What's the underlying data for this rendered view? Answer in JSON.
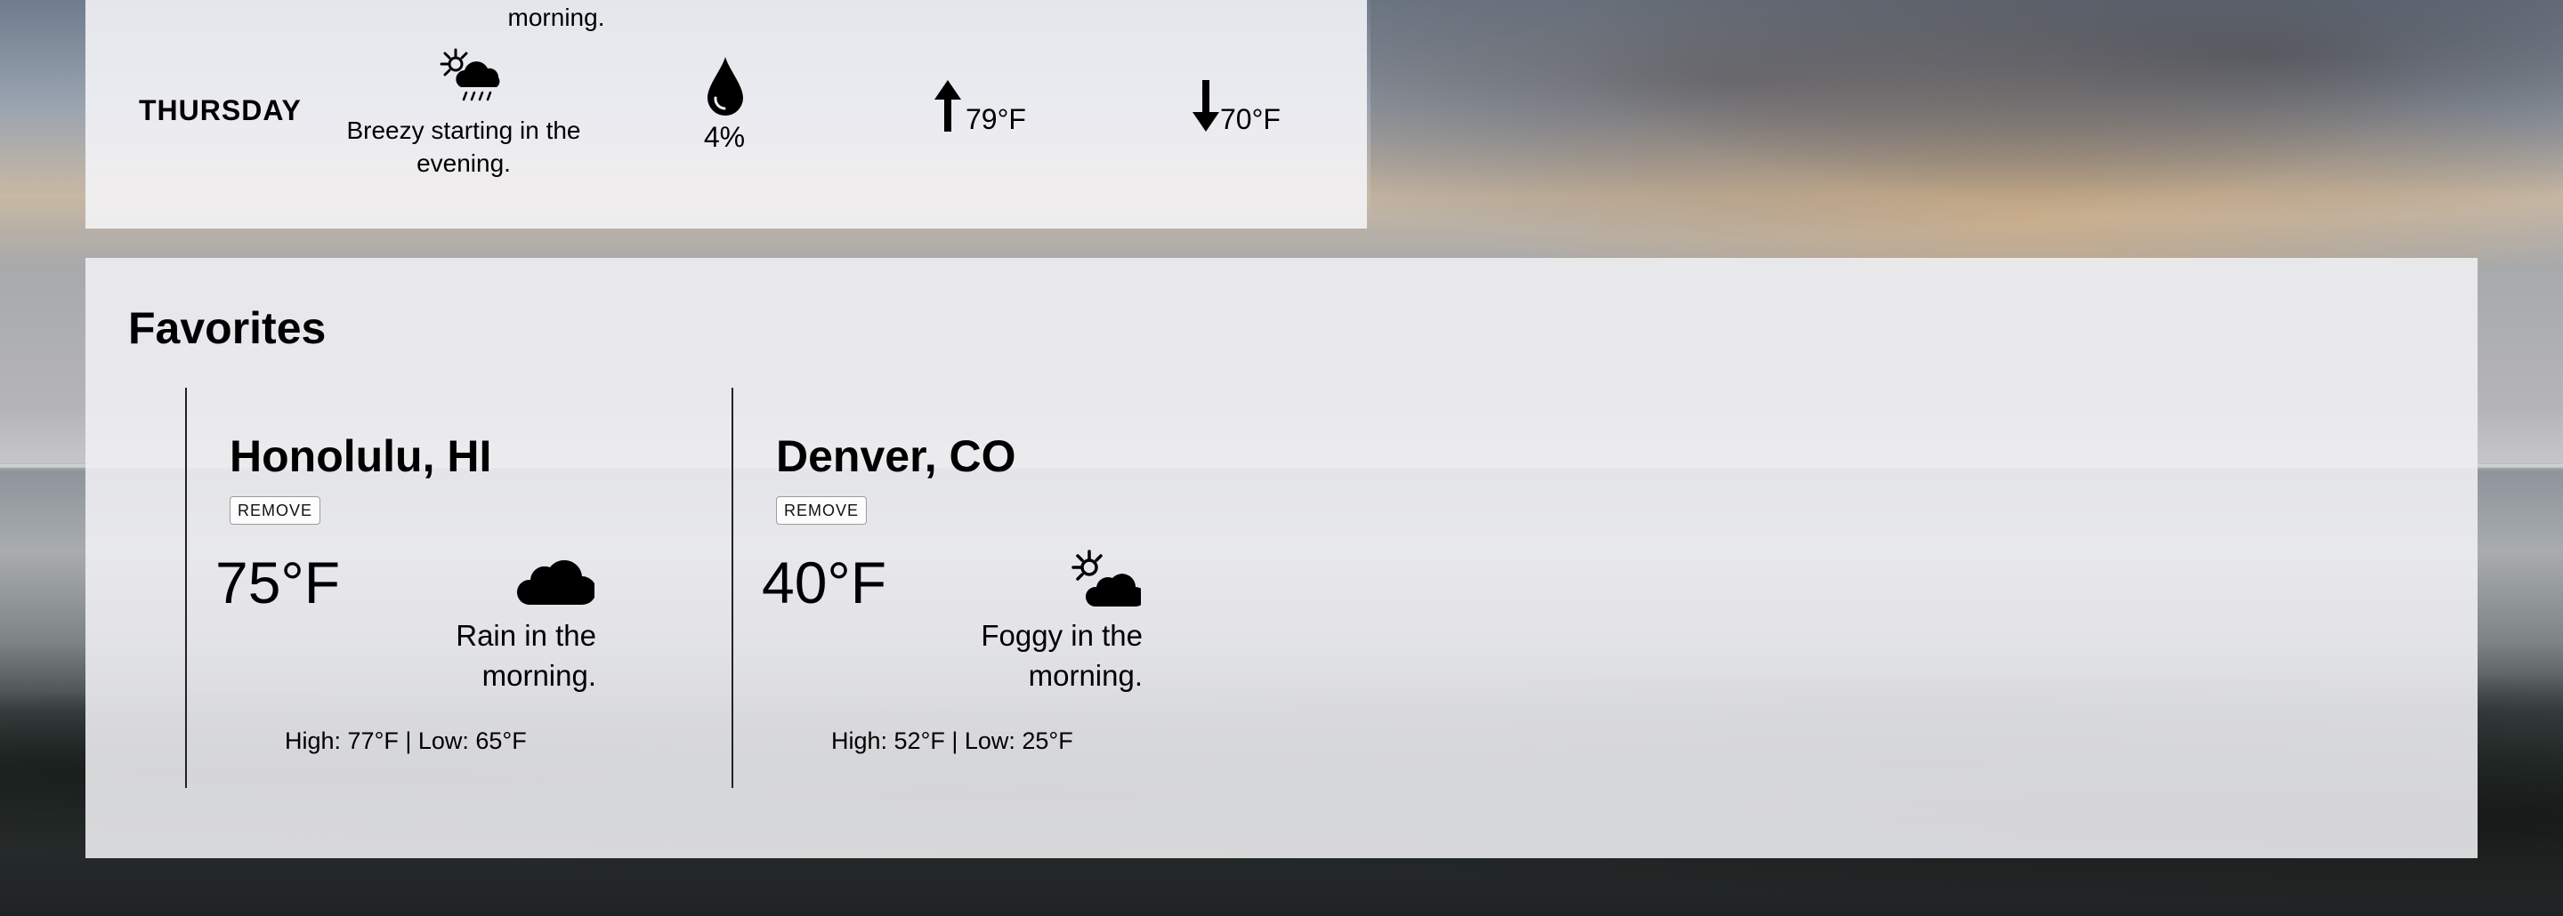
{
  "forecast": {
    "previous_description_tail": "morning.",
    "row": {
      "day": "THURSDAY",
      "icon": "sun-behind-rain-cloud-icon",
      "description": "Breezy starting in the evening.",
      "precip_icon": "raindrop-icon",
      "precip": "4%",
      "high_icon": "arrow-up-icon",
      "high": "79°F",
      "low_icon": "arrow-down-icon",
      "low": "70°F"
    }
  },
  "favorites": {
    "title": "Favorites",
    "cards": [
      {
        "city": "Honolulu, HI",
        "remove_label": "REMOVE",
        "temp": "75°F",
        "icon": "cloud-icon",
        "description": "Rain in the morning.",
        "hilo": "High: 77°F | Low: 65°F"
      },
      {
        "city": "Denver, CO",
        "remove_label": "REMOVE",
        "temp": "40°F",
        "icon": "sun-behind-cloud-icon",
        "description": "Foggy in the morning.",
        "hilo": "High: 52°F | Low: 25°F"
      }
    ]
  },
  "colors": {
    "panel_bg": "#f2f2f5",
    "text": "#000000"
  }
}
